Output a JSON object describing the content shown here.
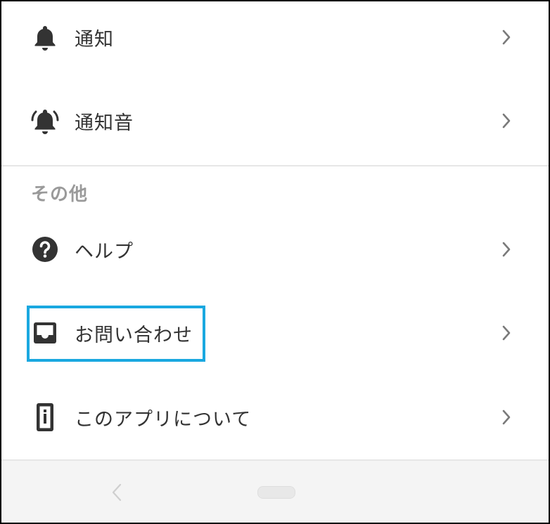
{
  "settings": {
    "items": [
      {
        "label": "通知",
        "icon": "bell-icon"
      },
      {
        "label": "通知音",
        "icon": "bell-ringing-icon"
      }
    ]
  },
  "other": {
    "header": "その他",
    "items": [
      {
        "label": "ヘルプ",
        "icon": "help-circle-icon"
      },
      {
        "label": "お問い合わせ",
        "icon": "inbox-icon"
      },
      {
        "label": "このアプリについて",
        "icon": "info-phone-icon"
      }
    ]
  },
  "navbar": {
    "back": "back-icon",
    "home": "home-pill"
  },
  "colors": {
    "highlight": "#1aa8e0",
    "icon": "#333333",
    "chevron": "#7a7a7a",
    "section_header": "#9a9a9a"
  }
}
